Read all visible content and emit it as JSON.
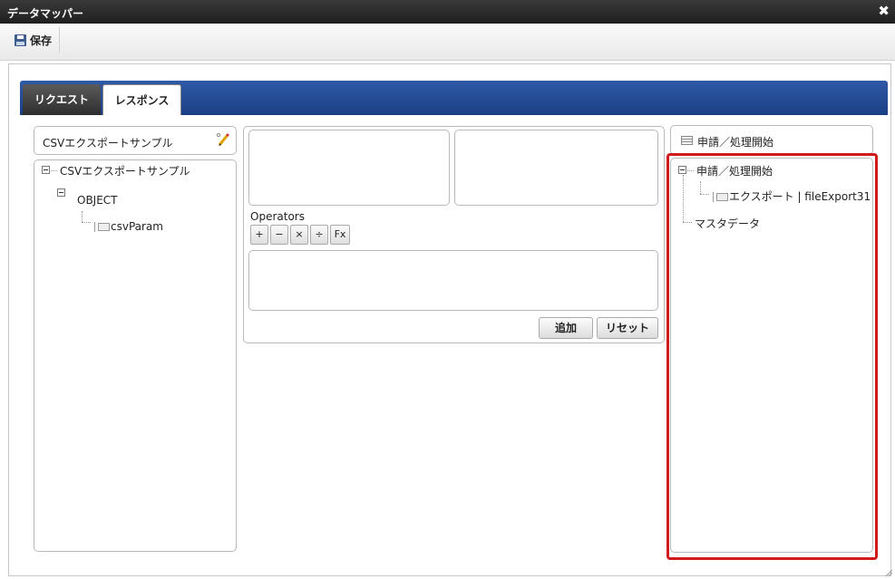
{
  "window": {
    "title": "データマッパー",
    "close_glyph": "✖"
  },
  "toolbar": {
    "save_label": "保存",
    "save_icon": "floppy-disk-icon"
  },
  "tabs": [
    {
      "label": "リクエスト",
      "active": false
    },
    {
      "label": "レスポンス",
      "active": true
    }
  ],
  "left_panel": {
    "header": "CSVエクスポートサンプル",
    "tree": {
      "root": "CSVエクスポートサンプル",
      "child": "OBJECT",
      "leaf": "csvParam"
    }
  },
  "middle_panel": {
    "operators_label": "Operators",
    "operators": [
      "+",
      "−",
      "×",
      "÷",
      "Fx"
    ],
    "add_button": "追加",
    "reset_button": "リセット"
  },
  "right_panel": {
    "header": "申請／処理開始",
    "tree": {
      "root": "申請／処理開始",
      "leaf": "エクスポート | fileExport31",
      "sibling": "マスタデータ"
    }
  },
  "colors": {
    "tab_bar": "#1b3f85",
    "title_bar": "#1f1f1f",
    "highlight": "#d11a1a"
  }
}
